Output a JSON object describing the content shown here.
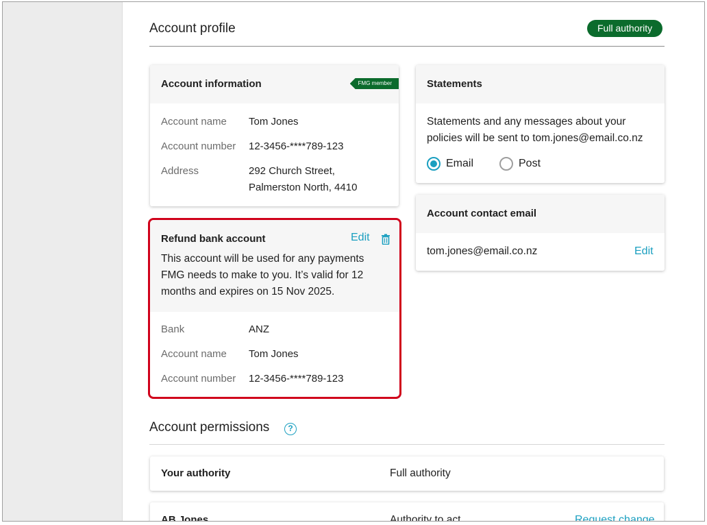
{
  "header": {
    "title": "Account profile",
    "authority_badge": "Full authority"
  },
  "account_info": {
    "title": "Account information",
    "member_badge": "FMG member",
    "rows": [
      {
        "label": "Account name",
        "value": "Tom Jones"
      },
      {
        "label": "Account number",
        "value": "12-3456-****789-123"
      },
      {
        "label": "Address",
        "value": "292 Church Street,",
        "value2": "Palmerston North, 4410"
      }
    ]
  },
  "refund": {
    "title": "Refund bank account",
    "edit_label": "Edit",
    "description": "This account will be used for any payments FMG needs to make to you. It’s valid for 12 months and expires on 15 Nov 2025.",
    "rows": [
      {
        "label": "Bank",
        "value": "ANZ"
      },
      {
        "label": "Account name",
        "value": "Tom Jones"
      },
      {
        "label": "Account number",
        "value": "12-3456-****789-123"
      }
    ]
  },
  "statements": {
    "title": "Statements",
    "text": "Statements and any messages about your policies will be sent to tom.jones@email.co.nz",
    "options": [
      {
        "label": "Email",
        "selected": true
      },
      {
        "label": "Post",
        "selected": false
      }
    ]
  },
  "contact": {
    "title": "Account contact email",
    "email": "tom.jones@email.co.nz",
    "edit_label": "Edit"
  },
  "permissions": {
    "title": "Account permissions",
    "help_icon": "?",
    "rows": [
      {
        "name": "Your authority",
        "authority": "Full authority",
        "action": ""
      },
      {
        "name": "AB Jones",
        "authority": "Authority to act",
        "action": "Request change"
      }
    ]
  },
  "colors": {
    "accent": "#1a9fc0",
    "brand_green": "#0b6b2c",
    "highlight_red": "#d0021b"
  }
}
